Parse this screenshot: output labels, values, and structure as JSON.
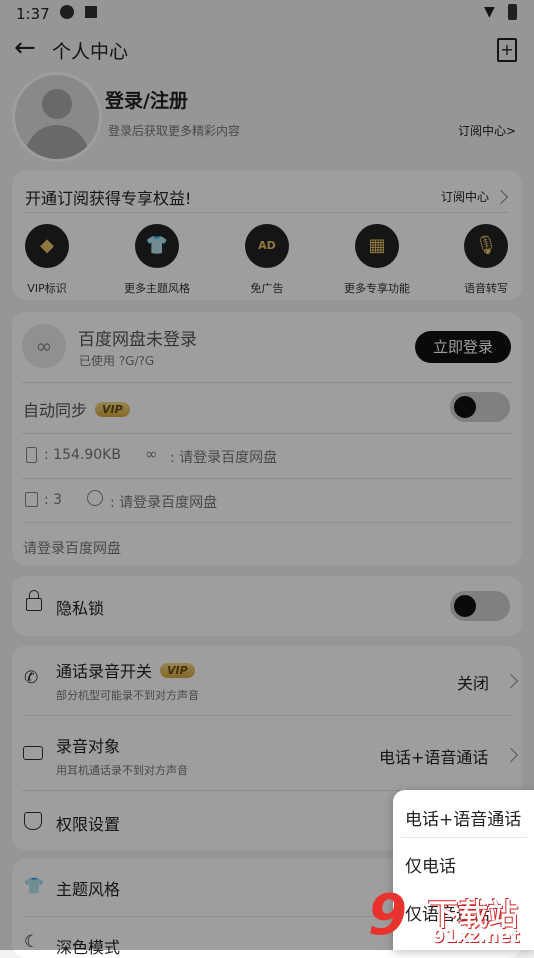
{
  "status_bar": {
    "time": "1:37"
  },
  "header": {
    "title": "个人中心"
  },
  "profile": {
    "login_label": "登录/注册",
    "subtitle": "登录后获取更多精彩内容",
    "subscribe_link": "订阅中心>"
  },
  "subscribe_card": {
    "title": "开通订阅获得专享权益!",
    "link": "订阅中心",
    "items": [
      {
        "label": "VIP标识",
        "icon": "vip-diamond-icon"
      },
      {
        "label": "更多主题风格",
        "icon": "shirt-icon"
      },
      {
        "label": "免广告",
        "icon": "ad-icon"
      },
      {
        "label": "更多专享功能",
        "icon": "grid-icon"
      },
      {
        "label": "语音转写",
        "icon": "mic-icon"
      }
    ]
  },
  "cloud": {
    "title": "百度网盘未登录",
    "usage": "已使用 ?G/?G",
    "login_button": "立即登录",
    "auto_sync": "自动同步",
    "vip": "VIP",
    "local_size": ": 154.90KB",
    "cloud_size": ": 请登录百度网盘",
    "file_count": ": 3",
    "sync_status": ": 请登录百度网盘",
    "footer": "请登录百度网盘"
  },
  "privacy": {
    "label": "隐私锁"
  },
  "recording": {
    "switch_label": "通话录音开关",
    "switch_vip": "VIP",
    "switch_note": "部分机型可能录不到对方声音",
    "switch_value": "关闭",
    "target_label": "录音对象",
    "target_note": "用耳机通话录不到对方声音",
    "target_value": "电话+语音通话",
    "permission_label": "权限设置"
  },
  "theme": {
    "label": "主题风格",
    "dark_label": "深色模式"
  },
  "popup_menu": {
    "options": [
      "电话+语音通话",
      "仅电话",
      "仅语音通话"
    ]
  },
  "watermark": {
    "text": "下载站",
    "domain": "91xz.net"
  }
}
